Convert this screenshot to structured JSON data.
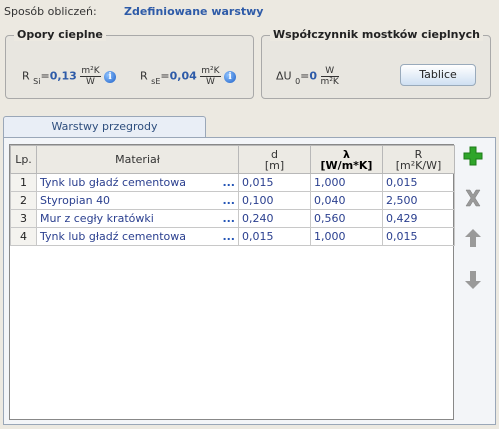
{
  "header": {
    "label": "Sposób obliczeń:",
    "value": "Zdefiniowane warstwy"
  },
  "opory": {
    "title": "Opory cieplne",
    "rsi": {
      "symbol": "R",
      "sub": "Si",
      "eq": "=",
      "value": "0,13",
      "unit_num": "m²K",
      "unit_den": "W"
    },
    "rse": {
      "symbol": "R",
      "sub": "sE",
      "eq": "=",
      "value": "0,04",
      "unit_num": "m²K",
      "unit_den": "W"
    },
    "info_icon": "i"
  },
  "mostki": {
    "title": "Współczynnik mostków cieplnych",
    "du": {
      "symbol": "ΔU",
      "sub": "0",
      "eq": "=",
      "value": "0",
      "unit_num": "W",
      "unit_den": "m²K"
    },
    "button": "Tablice"
  },
  "tab_label": "Warstwy przegrody",
  "table": {
    "headers": {
      "lp": "Lp.",
      "material": "Materiał",
      "d_top": "d",
      "d_bot": "[m]",
      "l_top": "λ",
      "l_bot": "[W/m*K]",
      "r_top": "R",
      "r_bot": "[m²K/W]"
    },
    "rows": [
      {
        "lp": "1",
        "material": "Tynk lub gładź cementowa",
        "dots": "...",
        "d": "0,015",
        "lambda": "1,000",
        "r": "0,015"
      },
      {
        "lp": "2",
        "material": "Styropian 40",
        "dots": "...",
        "d": "0,100",
        "lambda": "0,040",
        "r": "2,500"
      },
      {
        "lp": "3",
        "material": "Mur z cegły kratówki",
        "dots": "...",
        "d": "0,240",
        "lambda": "0,560",
        "r": "0,429"
      },
      {
        "lp": "4",
        "material": "Tynk lub gładź cementowa",
        "dots": "...",
        "d": "0,015",
        "lambda": "1,000",
        "r": "0,015"
      }
    ]
  },
  "icons": {
    "add": "plus-icon",
    "delete": "x-icon",
    "up": "arrow-up-icon",
    "down": "arrow-down-icon",
    "add_color": "#2fa52a",
    "disabled_color": "#9a9a9a"
  }
}
